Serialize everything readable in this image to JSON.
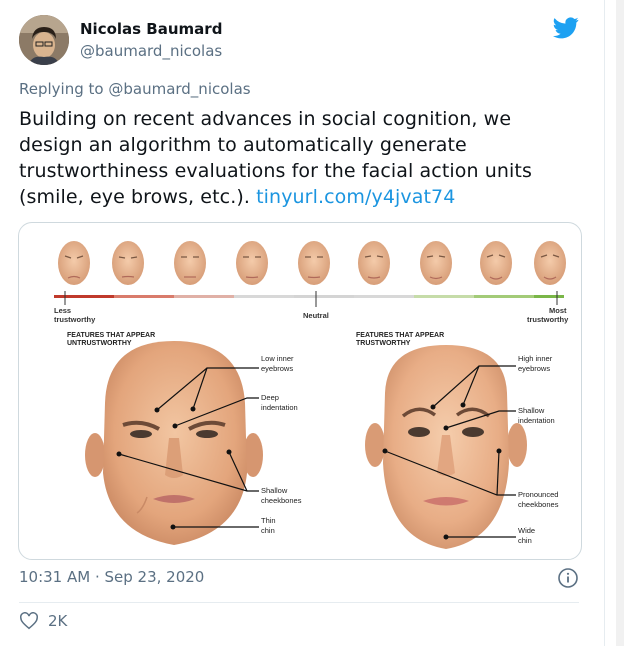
{
  "tweet": {
    "author_name": "Nicolas Baumard",
    "author_handle": "@baumard_nicolas",
    "reply_prefix": "Replying to",
    "reply_handle": "@baumard_nicolas",
    "text_line1": "Building on recent advances in social cognition, we",
    "text_line2": "design an algorithm to automatically generate",
    "text_line3": "trustworthiness evaluations for the facial action units",
    "text_line4": "(smile, eye brows, etc.).",
    "link": "tinyurl.com/y4jvat74",
    "timestamp": "10:31 AM · Sep 23, 2020",
    "likes": "2K"
  },
  "figure": {
    "scale_left_1": "Less",
    "scale_left_2": "trustworthy",
    "scale_mid": "Neutral",
    "scale_right_1": "Most",
    "scale_right_2": "trustworthy",
    "left_heading_1": "FEATURES THAT APPEAR",
    "left_heading_2": "UNTRUSTWORTHY",
    "right_heading_1": "FEATURES THAT APPEAR",
    "right_heading_2": "TRUSTWORTHY",
    "left_labels": {
      "low_inner_1": "Low inner",
      "low_inner_2": "eyebrows",
      "deep_1": "Deep",
      "deep_2": "indentation",
      "shallow_cheek_1": "Shallow",
      "shallow_cheek_2": "cheekbones",
      "thin_chin_1": "Thin",
      "thin_chin_2": "chin"
    },
    "right_labels": {
      "high_inner_1": "High inner",
      "high_inner_2": "eyebrows",
      "shallow_ind_1": "Shallow",
      "shallow_ind_2": "indentation",
      "pron_cheek_1": "Pronounced",
      "pron_cheek_2": "cheekbones",
      "wide_chin_1": "Wide",
      "wide_chin_2": "chin"
    }
  },
  "colors": {
    "twitter_blue": "#1da1f2",
    "link_blue": "#1b95e0",
    "secondary_text": "#5b7083",
    "scale_red": "#c0392b",
    "scale_green": "#7ab648"
  },
  "icons": {
    "brand": "twitter-bird-icon",
    "info": "info-circle-icon",
    "like": "heart-outline-icon"
  }
}
